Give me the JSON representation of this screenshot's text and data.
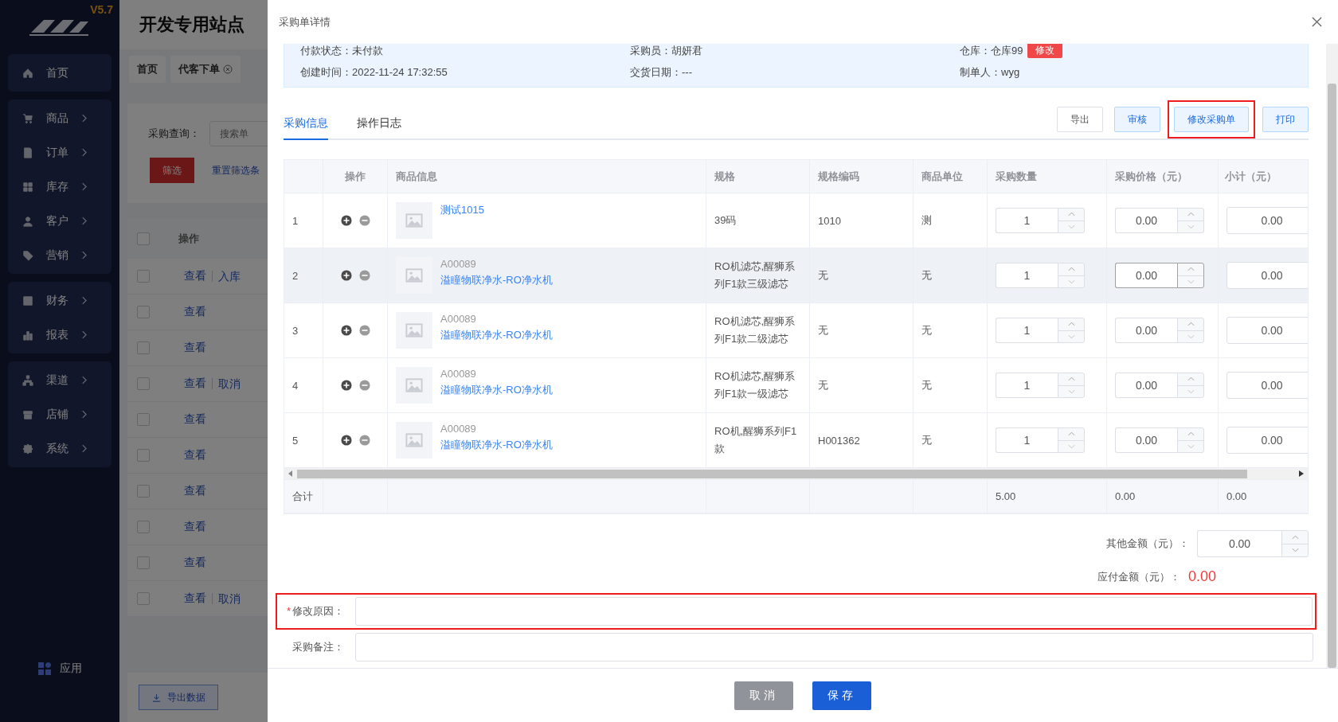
{
  "sidebar": {
    "version": "V5.7",
    "groups": [
      {
        "items": [
          {
            "label": "首页",
            "expandable": false
          }
        ]
      },
      {
        "items": [
          {
            "label": "商品",
            "expandable": true
          },
          {
            "label": "订单",
            "expandable": true
          },
          {
            "label": "库存",
            "expandable": true
          },
          {
            "label": "客户",
            "expandable": true
          },
          {
            "label": "营销",
            "expandable": true
          }
        ]
      },
      {
        "items": [
          {
            "label": "财务",
            "expandable": true
          },
          {
            "label": "报表",
            "expandable": true
          }
        ]
      },
      {
        "items": [
          {
            "label": "渠道",
            "expandable": true
          },
          {
            "label": "店铺",
            "expandable": true
          },
          {
            "label": "系统",
            "expandable": true
          }
        ]
      }
    ],
    "apps": "应用"
  },
  "page": {
    "title": "开发专用站点",
    "tabs": [
      {
        "label": "首页",
        "closable": false
      },
      {
        "label": "代客下单",
        "closable": true
      }
    ],
    "search_label": "采购查询：",
    "search_placeholder": "搜索单",
    "filter_button": "筛选",
    "reset_link": "重置筛选条",
    "action_header": "操作",
    "all_checked": false,
    "rows": [
      {
        "checked": false,
        "actions": [
          "查看",
          "入库"
        ]
      },
      {
        "checked": false,
        "actions": [
          "查看"
        ]
      },
      {
        "checked": false,
        "actions": [
          "查看"
        ]
      },
      {
        "checked": false,
        "actions": [
          "查看",
          "取消"
        ]
      },
      {
        "checked": false,
        "actions": [
          "查看"
        ]
      },
      {
        "checked": false,
        "actions": [
          "查看"
        ]
      },
      {
        "checked": false,
        "actions": [
          "查看"
        ]
      },
      {
        "checked": false,
        "actions": [
          "查看"
        ]
      },
      {
        "checked": false,
        "actions": [
          "查看"
        ]
      },
      {
        "checked": false,
        "actions": [
          "查看",
          "取消"
        ]
      }
    ],
    "export_button": "导出数据"
  },
  "drawer": {
    "title": "采购单详情",
    "info": [
      [
        {
          "label": "付款状态：",
          "value": "未付款"
        },
        {
          "label": "采购员：",
          "value": "胡妍君"
        },
        {
          "label": "仓库：",
          "value": "仓库99",
          "tag": "修改"
        }
      ],
      [
        {
          "label": "创建时间：",
          "value": "2022-11-24 17:32:55"
        },
        {
          "label": "交货日期：",
          "value": "---"
        },
        {
          "label": "制单人：",
          "value": "wyg"
        }
      ]
    ],
    "tabs": [
      {
        "label": "采购信息",
        "selected": true
      },
      {
        "label": "操作日志",
        "selected": false
      }
    ],
    "actions": [
      {
        "label": "导出",
        "kind": "plain",
        "highlighted": false
      },
      {
        "label": "审核",
        "kind": "primary",
        "highlighted": false
      },
      {
        "label": "修改采购单",
        "kind": "primary",
        "highlighted": true
      },
      {
        "label": "打印",
        "kind": "primary",
        "highlighted": false
      }
    ],
    "table": {
      "columns": [
        "",
        "操作",
        "商品信息",
        "规格",
        "规格编码",
        "商品单位",
        "采购数量",
        "采购价格（元）",
        "小计（元）"
      ],
      "rows": [
        {
          "index": "1",
          "code": "",
          "name": "测试1015",
          "spec": "39码",
          "spec_code": "1010",
          "unit": "测",
          "qty": "1",
          "price": "0.00",
          "subtotal": "0.00",
          "hovered": false
        },
        {
          "index": "2",
          "code": "A00089",
          "name": "溢瞳物联净水-RO净水机",
          "spec": "RO机滤芯,醒狮系列F1款三级滤芯",
          "spec_code": "无",
          "unit": "无",
          "qty": "1",
          "price": "0.00",
          "subtotal": "0.00",
          "hovered": true
        },
        {
          "index": "3",
          "code": "A00089",
          "name": "溢瞳物联净水-RO净水机",
          "spec": "RO机滤芯,醒狮系列F1款二级滤芯",
          "spec_code": "无",
          "unit": "无",
          "qty": "1",
          "price": "0.00",
          "subtotal": "0.00",
          "hovered": false
        },
        {
          "index": "4",
          "code": "A00089",
          "name": "溢瞳物联净水-RO净水机",
          "spec": "RO机滤芯,醒狮系列F1款一级滤芯",
          "spec_code": "无",
          "unit": "无",
          "qty": "1",
          "price": "0.00",
          "subtotal": "0.00",
          "hovered": false
        },
        {
          "index": "5",
          "code": "A00089",
          "name": "溢瞳物联净水-RO净水机",
          "spec": "RO机,醒狮系列F1款",
          "spec_code": "H001362",
          "unit": "无",
          "qty": "1",
          "price": "0.00",
          "subtotal": "0.00",
          "hovered": false
        }
      ],
      "footer": {
        "label": "合计",
        "qty": "5.00",
        "price": "0.00",
        "subtotal": "0.00"
      }
    },
    "other_amount": {
      "label": "其他金额（元）：",
      "value": "0.00"
    },
    "payable": {
      "label": "应付金额（元）：",
      "value": "0.00"
    },
    "reason": {
      "required": true,
      "required_mark": "*",
      "label": "修改原因：",
      "highlighted": true
    },
    "remark": {
      "label": "采购备注："
    },
    "buttons": [
      {
        "label": "取消",
        "kind": "cancel"
      },
      {
        "label": "保存",
        "kind": "primary"
      }
    ]
  }
}
